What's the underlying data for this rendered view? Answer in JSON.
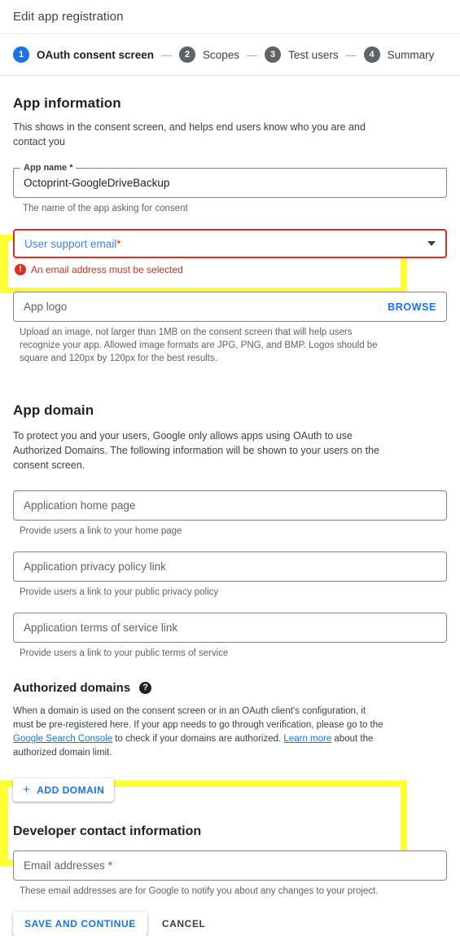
{
  "header": {
    "title": "Edit app registration"
  },
  "stepper": {
    "steps": [
      {
        "num": "1",
        "label": "OAuth consent screen",
        "active": true
      },
      {
        "num": "2",
        "label": "Scopes",
        "active": false
      },
      {
        "num": "3",
        "label": "Test users",
        "active": false
      },
      {
        "num": "4",
        "label": "Summary",
        "active": false
      }
    ],
    "separator": "—"
  },
  "app_information": {
    "title": "App information",
    "description": "This shows in the consent screen, and helps end users know who you are and contact you",
    "app_name": {
      "label": "App name *",
      "value": "Octoprint-GoogleDriveBackup",
      "help": "The name of the app asking for consent"
    },
    "user_support_email": {
      "label": "User support email",
      "required_mark": "*",
      "error": "An email address must be selected",
      "error_icon": "error-exclamation-icon",
      "caret_icon": "chevron-down-icon"
    },
    "app_logo": {
      "placeholder": "App logo",
      "browse_label": "BROWSE",
      "help": "Upload an image, not larger than 1MB on the consent screen that will help users recognize your app. Allowed image formats are JPG, PNG, and BMP. Logos should be square and 120px by 120px for the best results."
    }
  },
  "app_domain": {
    "title": "App domain",
    "description": "To protect you and your users, Google only allows apps using OAuth to use Authorized Domains. The following information will be shown to your users on the consent screen.",
    "fields": [
      {
        "placeholder": "Application home page",
        "help": "Provide users a link to your home page"
      },
      {
        "placeholder": "Application privacy policy link",
        "help": "Provide users a link to your public privacy policy"
      },
      {
        "placeholder": "Application terms of service link",
        "help": "Provide users a link to your public terms of service"
      }
    ]
  },
  "authorized_domains": {
    "title": "Authorized domains",
    "help_icon": "help-circle-icon",
    "desc_part1": "When a domain is used on the consent screen or in an OAuth client's configuration, it must be pre-registered here. If your app needs to go through verification, please go to the ",
    "link1": "Google Search Console",
    "desc_part2": " to check if your domains are authorized. ",
    "link2": "Learn more",
    "desc_part3": " about the authorized domain limit.",
    "add_domain_label": "ADD DOMAIN",
    "add_icon": "plus-icon"
  },
  "developer_contact": {
    "title": "Developer contact information",
    "email_placeholder": "Email addresses",
    "required_mark": "*",
    "help": "These email addresses are for Google to notify you about any changes to your project."
  },
  "footer": {
    "save_label": "SAVE AND CONTINUE",
    "cancel_label": "CANCEL"
  },
  "colors": {
    "accent": "#1a73e8",
    "error": "#d93025",
    "highlight": "#ffff33",
    "step_inactive": "#5f6368"
  }
}
